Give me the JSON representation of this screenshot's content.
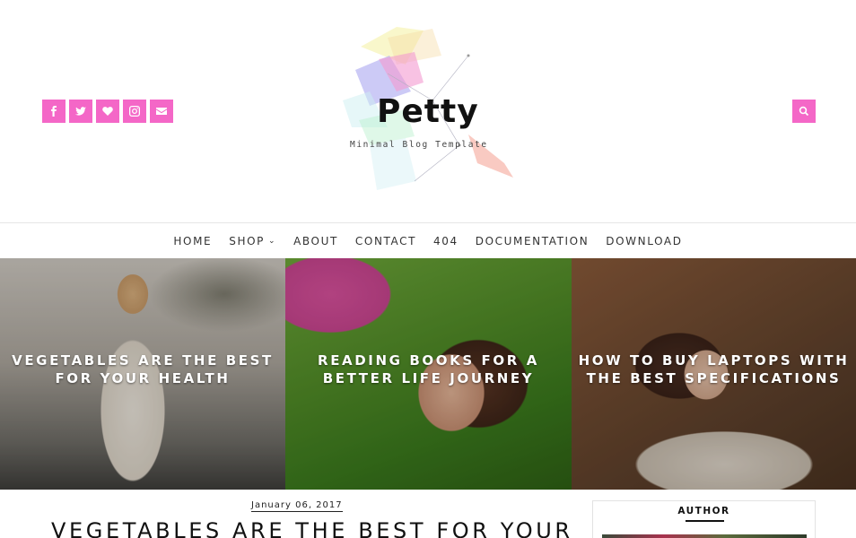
{
  "site": {
    "logo_text": "Petty",
    "tagline": "Minimal Blog Template"
  },
  "header": {
    "social_icons": [
      "facebook-icon",
      "twitter-icon",
      "heart-icon",
      "instagram-icon",
      "envelope-icon"
    ],
    "search_icon": "search-icon",
    "accent_color": "#f467c7"
  },
  "nav": {
    "items": [
      {
        "label": "HOME"
      },
      {
        "label": "SHOP"
      },
      {
        "label": "ABOUT"
      },
      {
        "label": "CONTACT"
      },
      {
        "label": "404"
      },
      {
        "label": "DOCUMENTATION"
      },
      {
        "label": "DOWNLOAD"
      }
    ]
  },
  "slider": {
    "slides": [
      {
        "title": "VEGETABLES ARE THE BEST FOR YOUR HEALTH"
      },
      {
        "title": "READING BOOKS FOR A BETTER LIFE JOURNEY"
      },
      {
        "title": "HOW TO BUY LAPTOPS WITH THE BEST SPECIFICATIONS"
      }
    ]
  },
  "post": {
    "date": "January 06, 2017",
    "title": "VEGETABLES ARE THE BEST FOR YOUR"
  },
  "sidebar": {
    "author_title": "AUTHOR"
  }
}
